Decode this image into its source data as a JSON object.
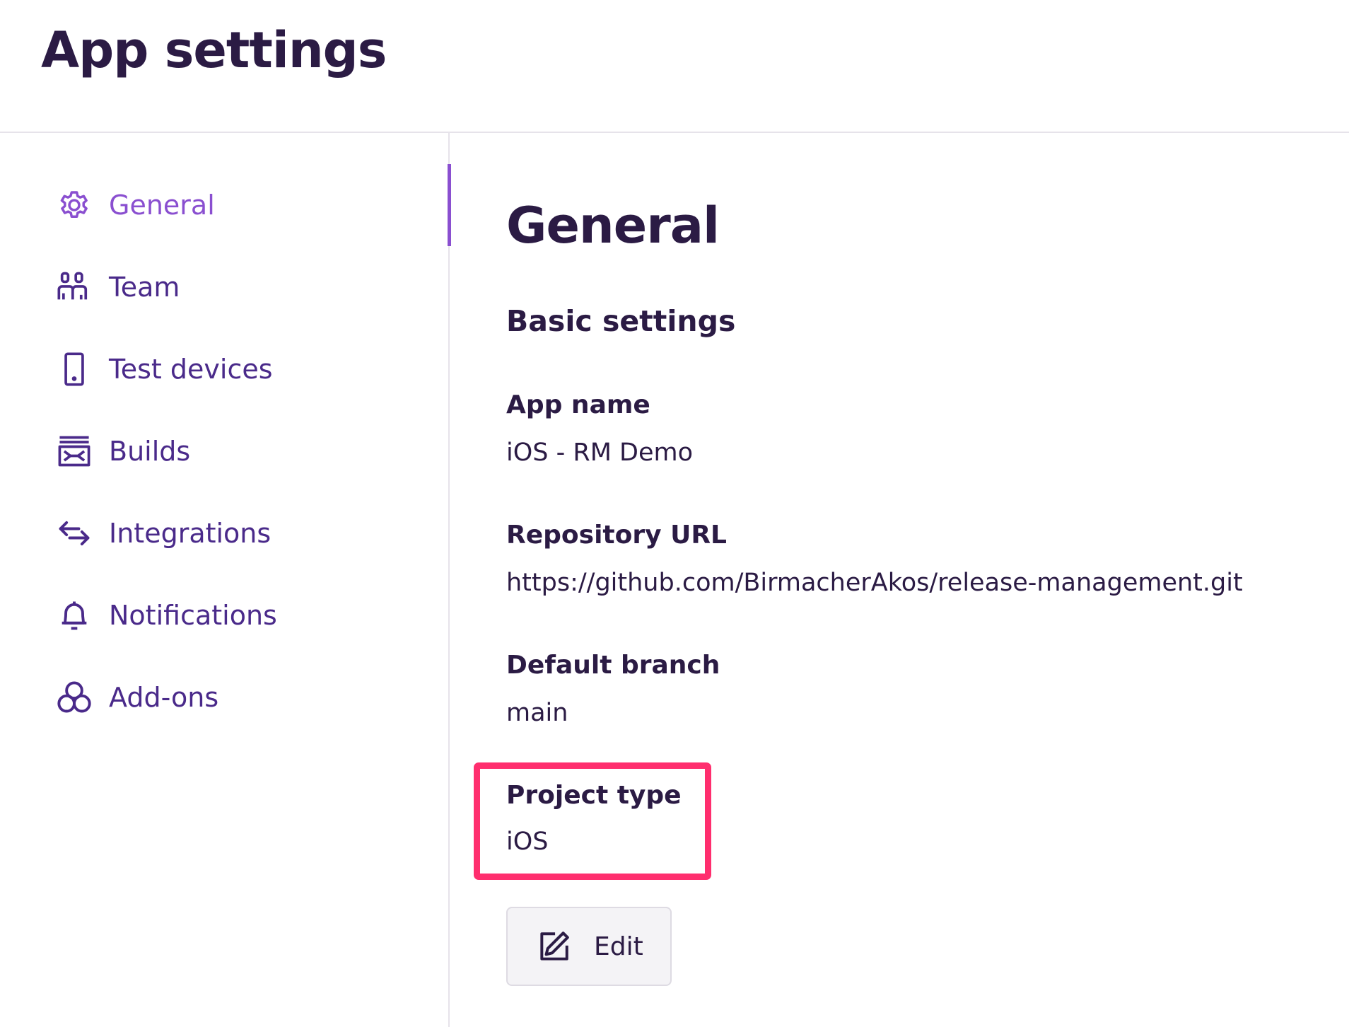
{
  "header": {
    "title": "App settings"
  },
  "sidebar": {
    "items": [
      {
        "label": "General",
        "icon": "gear-icon",
        "active": true
      },
      {
        "label": "Team",
        "icon": "team-icon",
        "active": false
      },
      {
        "label": "Test devices",
        "icon": "phone-icon",
        "active": false
      },
      {
        "label": "Builds",
        "icon": "builds-icon",
        "active": false
      },
      {
        "label": "Integrations",
        "icon": "integrations-icon",
        "active": false
      },
      {
        "label": "Notifications",
        "icon": "bell-icon",
        "active": false
      },
      {
        "label": "Add-ons",
        "icon": "addons-icon",
        "active": false
      }
    ]
  },
  "main": {
    "title": "General",
    "subtitle": "Basic settings",
    "fields": [
      {
        "label": "App name",
        "value": "iOS - RM Demo"
      },
      {
        "label": "Repository URL",
        "value": "https://github.com/BirmacherAkos/release-management.git"
      },
      {
        "label": "Default branch",
        "value": "main"
      },
      {
        "label": "Project type",
        "value": "iOS"
      }
    ],
    "edit_button": {
      "label": "Edit",
      "icon": "edit-icon"
    }
  },
  "colors": {
    "text_dark": "#2b1b44",
    "nav_text": "#4a2a8a",
    "accent": "#8a4fd0",
    "highlight": "#ff2e6e",
    "divider": "#e6e3ea"
  }
}
